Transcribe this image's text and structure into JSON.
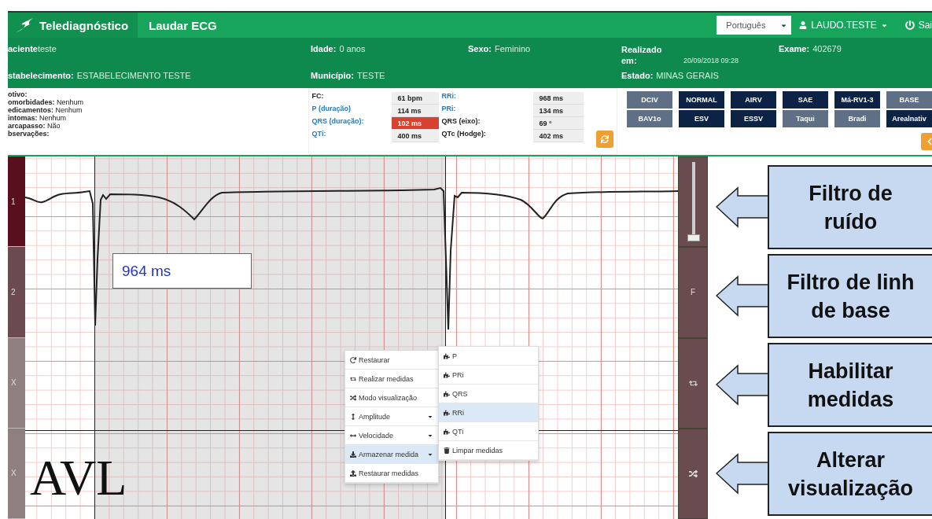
{
  "navbar": {
    "brand": "Telediagnóstico",
    "title": "Laudar ECG",
    "language": "Português",
    "user": "LAUDO.TESTE",
    "logout": "Sai"
  },
  "patient": {
    "row1": [
      {
        "label": "aciente",
        "value": "teste"
      },
      {
        "label": "Idade:",
        "value": "0  anos"
      },
      {
        "label": "Sexo:",
        "value": "Feminino"
      },
      {
        "label": "Realizado em:",
        "value": "20/09/2018 09:28",
        "kind": "small"
      },
      {
        "label": "Exame:",
        "value": "402679"
      }
    ],
    "row2": [
      {
        "label": "stabelecimento:",
        "value": "ESTABELECIMENTO TESTE"
      },
      {
        "label": "Município:",
        "value": "TESTE"
      },
      {
        "label": "Estado:",
        "value": "MINAS GERAIS"
      }
    ]
  },
  "notes": [
    {
      "label": "otivo:"
    },
    {
      "label": "omorbidades:",
      "value": "Nenhum"
    },
    {
      "label": "edicamentos:",
      "value": "Nenhum"
    },
    {
      "label": "intomas:",
      "value": "Nenhum"
    },
    {
      "label": "arcapasso:",
      "value": "Não"
    },
    {
      "label": "bservações:"
    }
  ],
  "measurements": [
    {
      "label": "FC:",
      "value": "61 bpm",
      "measured": false,
      "alert": false
    },
    {
      "label": "RRi:",
      "value": "968 ms",
      "measured": true,
      "alert": false
    },
    {
      "label": "P (duração)",
      "value": "114 ms",
      "measured": true,
      "alert": false
    },
    {
      "label": "PRi:",
      "value": "134 ms",
      "measured": true,
      "alert": false
    },
    {
      "label": "QRS (duração):",
      "value": "102 ms",
      "measured": true,
      "alert": true
    },
    {
      "label": "QRS (eixo):",
      "value": "69 °",
      "measured": false,
      "alert": false
    },
    {
      "label": "QTi:",
      "value": "400 ms",
      "measured": true,
      "alert": false
    },
    {
      "label": "QTc (Hodge):",
      "value": "402 ms",
      "measured": false,
      "alert": false
    }
  ],
  "diagnoses": [
    {
      "label": "DCIV",
      "selected": false
    },
    {
      "label": "NORMAL",
      "selected": true
    },
    {
      "label": "AIRV",
      "selected": true
    },
    {
      "label": "SAE",
      "selected": true
    },
    {
      "label": "Má-RV1-3",
      "selected": true
    },
    {
      "label": "BASE",
      "selected": false
    },
    {
      "label": "BAV1o",
      "selected": false
    },
    {
      "label": "ESV",
      "selected": true
    },
    {
      "label": "ESSV",
      "selected": true
    },
    {
      "label": "Taqui",
      "selected": false
    },
    {
      "label": "Bradi",
      "selected": false
    },
    {
      "label": "Arealnativ",
      "selected": true
    }
  ],
  "channels": [
    {
      "label": "1",
      "selected": true
    },
    {
      "label": "2",
      "selected": false
    },
    {
      "label": "X",
      "selected": false
    },
    {
      "label": "X",
      "selected": false
    }
  ],
  "ecg": {
    "measure": "964 ms",
    "lead": "AVL"
  },
  "context_menu": [
    {
      "label": "Restaurar",
      "kind": "restore",
      "submenu": false,
      "selected": false
    },
    {
      "label": "Realizar medidas",
      "kind": "measure",
      "submenu": false,
      "selected": false
    },
    {
      "label": "Modo visualização",
      "kind": "view",
      "submenu": false,
      "selected": false
    },
    {
      "label": "Amplitude",
      "kind": "amplitude",
      "submenu": true,
      "selected": false
    },
    {
      "label": "Velocidade",
      "kind": "speed",
      "submenu": true,
      "selected": false
    },
    {
      "label": "Armazenar medida",
      "kind": "store",
      "submenu": true,
      "selected": true
    },
    {
      "label": "Restaurar medidas",
      "kind": "reload",
      "submenu": false,
      "selected": false
    }
  ],
  "submenu": [
    {
      "label": "P",
      "kind": "measure",
      "selected": false
    },
    {
      "label": "PRi",
      "kind": "measure",
      "selected": false
    },
    {
      "label": "QRS",
      "kind": "measure",
      "selected": false
    },
    {
      "label": "RRi",
      "kind": "measure",
      "selected": true
    },
    {
      "label": "QTi",
      "kind": "measure",
      "selected": false
    },
    {
      "label": "Limpar medidas",
      "kind": "clear",
      "selected": false
    }
  ],
  "tools": [
    {
      "kind": "slider",
      "level": 0
    },
    {
      "kind": "text",
      "label": "F"
    },
    {
      "kind": "measure"
    },
    {
      "kind": "shuffle"
    }
  ],
  "callouts": [
    {
      "text": "Filtro de\nruído"
    },
    {
      "text": "Filtro de linh\nde base"
    },
    {
      "text": "Habilitar\nmedidas"
    },
    {
      "text": "Alterar\nvisualização"
    }
  ]
}
